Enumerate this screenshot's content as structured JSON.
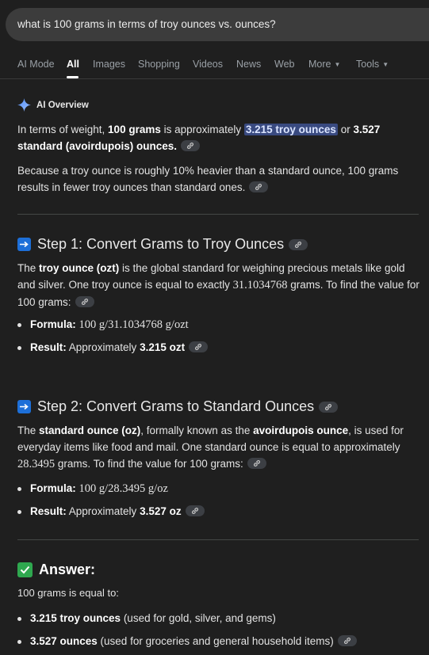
{
  "search": {
    "query": "what is 100 grams in terms of troy ounces vs. ounces?"
  },
  "tabs": [
    "AI Mode",
    "All",
    "Images",
    "Shopping",
    "Videos",
    "News",
    "Web",
    "More",
    "Tools"
  ],
  "overview": {
    "heading": "AI Overview",
    "p1": {
      "a": "In terms of weight, ",
      "b": "100 grams",
      "c": " is approximately ",
      "hl": "3.215 troy ounces",
      "d": " or ",
      "e": "3.527 standard (avoirdupois) ounces."
    },
    "p2": "Because a troy ounce is roughly 10% heavier than a standard ounce, 100 grams results in fewer troy ounces than standard ones."
  },
  "step1": {
    "title": "Step 1: Convert Grams to Troy Ounces",
    "p": {
      "a": "The ",
      "b": "troy ounce (ozt)",
      "c": " is the global standard for weighing precious metals like gold and silver. One troy ounce is equal to exactly ",
      "num": "31.1034768",
      "d": " grams. To find the value for 100 grams:"
    },
    "formula_label": "Formula:",
    "formula": "100 g/31.1034768 g/ozt",
    "result_label": "Result:",
    "result_text": " Approximately ",
    "result_value": "3.215 ozt"
  },
  "step2": {
    "title": "Step 2: Convert Grams to Standard Ounces",
    "p": {
      "a": "The ",
      "b": "standard ounce (oz)",
      "c": ", formally known as the ",
      "d": "avoirdupois ounce",
      "e": ", is used for everyday items like food and mail. One standard ounce is equal to approximately ",
      "num": "28.3495",
      "f": " grams. To find the value for 100 grams:"
    },
    "formula_label": "Formula:",
    "formula": "100 g/28.3495 g/oz",
    "result_label": "Result:",
    "result_text": " Approximately ",
    "result_value": "3.527 oz"
  },
  "answer": {
    "title": "Answer:",
    "intro": "100 grams is equal to:",
    "items": [
      {
        "value": "3.215 troy ounces",
        "note": " (used for gold, silver, and gems)"
      },
      {
        "value": "3.527 ounces",
        "note": " (used for groceries and general household items)"
      }
    ]
  },
  "colors": {
    "background": "#1f1f1f",
    "highlight": "#394a80",
    "step_icon": "#1d6fd8",
    "check_icon": "#2fa84f"
  },
  "icons": [
    "sparkle-icon",
    "link-icon",
    "arrow-right-icon",
    "check-icon",
    "caret-down-icon"
  ]
}
